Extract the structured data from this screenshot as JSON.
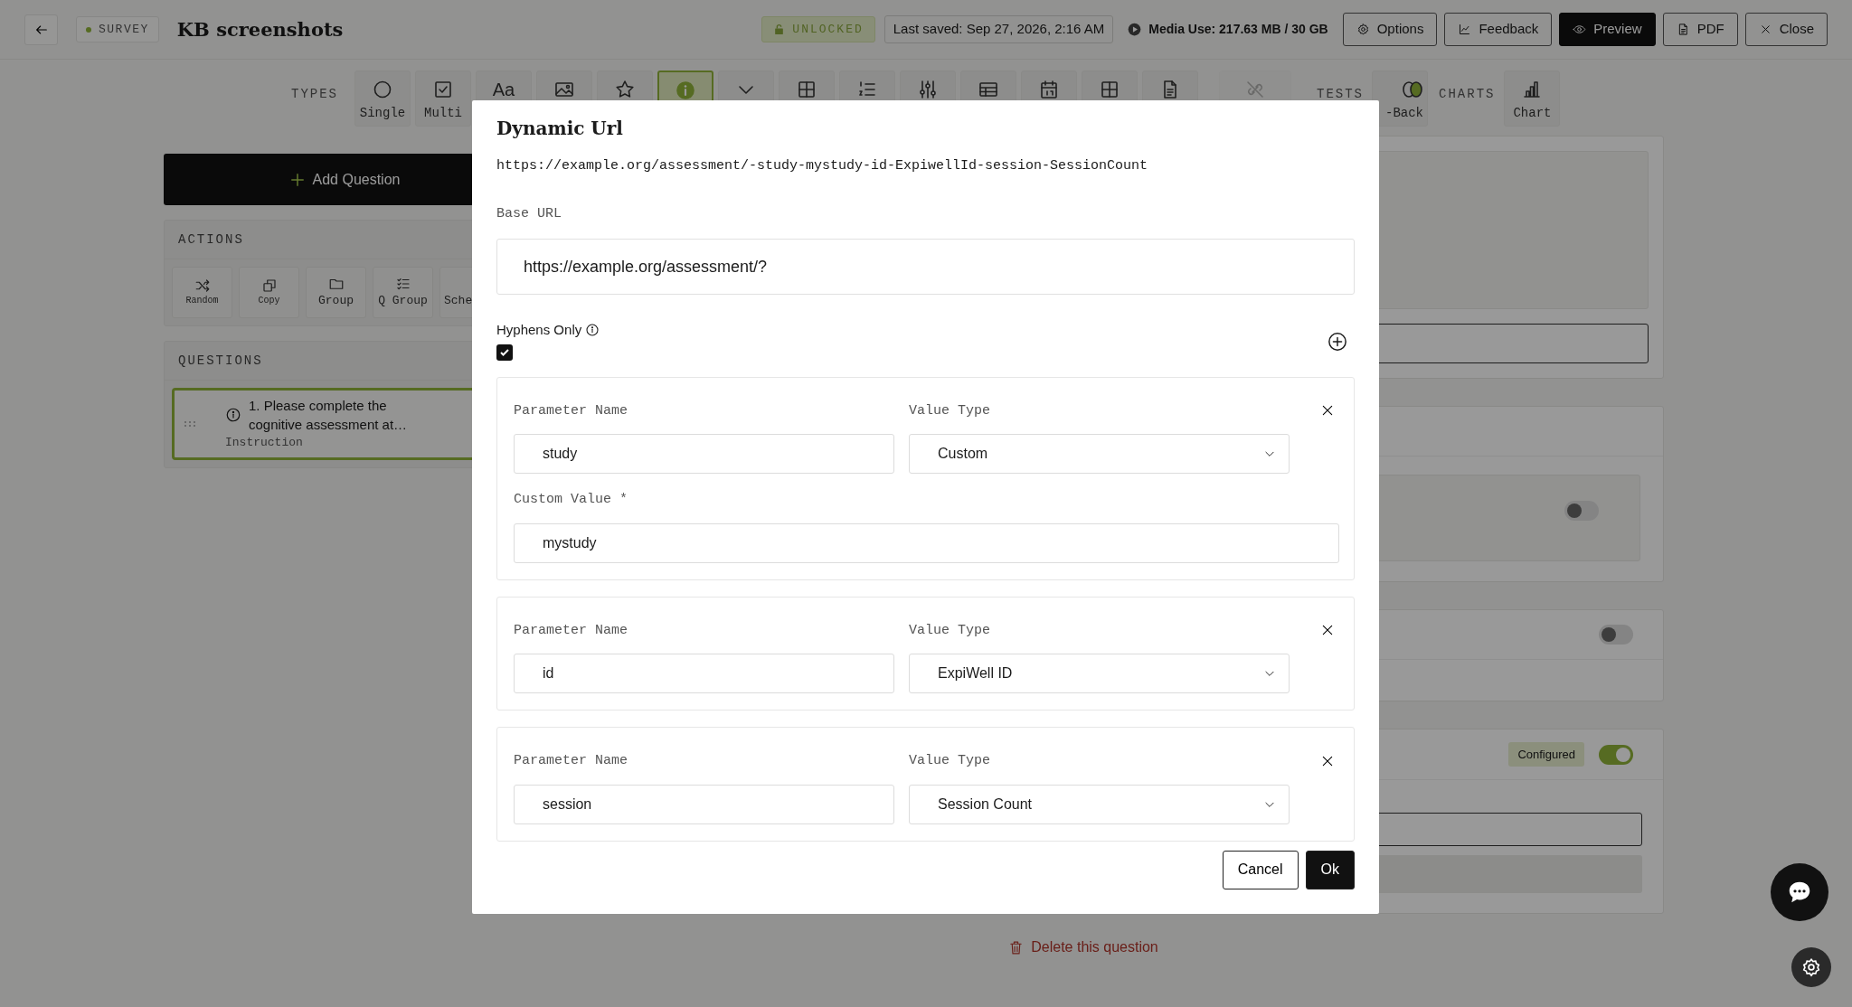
{
  "header": {
    "type_tag": "SURVEY",
    "title": "KB screenshots",
    "lock_status": "UNLOCKED",
    "last_saved": "Last saved: Sep 27, 2026, 2:16 AM",
    "media_use": "Media Use: 217.63 MB / 30 GB",
    "buttons": [
      {
        "kind": "gear",
        "label": "Options",
        "primary": false
      },
      {
        "kind": "chart-line",
        "label": "Feedback",
        "primary": false
      },
      {
        "kind": "eye",
        "label": "Preview",
        "primary": true
      },
      {
        "kind": "file",
        "label": "PDF",
        "primary": false
      },
      {
        "kind": "x",
        "label": "Close",
        "primary": false
      }
    ]
  },
  "toolbar": {
    "types_label": "TYPES",
    "types": [
      {
        "kind": "circle",
        "label": "Single",
        "selected": false,
        "disabled": false
      },
      {
        "kind": "checkbox",
        "label": "Multi",
        "selected": false,
        "disabled": false
      },
      {
        "kind": "glyph",
        "glyph": "Aa",
        "selected": false,
        "disabled": false
      },
      {
        "kind": "image",
        "selected": false,
        "disabled": false
      },
      {
        "kind": "star",
        "selected": false,
        "disabled": false
      },
      {
        "kind": "info",
        "selected": true,
        "disabled": false
      },
      {
        "kind": "chevron",
        "selected": false,
        "disabled": false
      },
      {
        "kind": "grid",
        "selected": false,
        "disabled": false
      },
      {
        "kind": "numlist",
        "selected": false,
        "disabled": false
      },
      {
        "kind": "sliders",
        "selected": false,
        "disabled": false
      },
      {
        "kind": "table",
        "selected": false,
        "disabled": false
      },
      {
        "kind": "calendar",
        "selected": false,
        "disabled": false
      },
      {
        "kind": "grid",
        "selected": false,
        "disabled": false
      },
      {
        "kind": "file",
        "selected": false,
        "disabled": false
      },
      {
        "kind": "link",
        "selected": false,
        "disabled": true
      }
    ],
    "tests_label": "TESTS",
    "tests": [
      {
        "kind": "brain",
        "label": "-Back"
      }
    ],
    "charts_label": "CHARTS",
    "charts": [
      {
        "kind": "bars",
        "label": "Chart"
      }
    ]
  },
  "sidebar": {
    "add_button": "Add Question",
    "actions_label": "ACTIONS",
    "actions": [
      {
        "kind": "shuffle",
        "label": "Random"
      },
      {
        "kind": "copy",
        "label": "Copy"
      },
      {
        "kind": "folder",
        "label": "Group"
      },
      {
        "kind": "checklist",
        "label": "Q Group"
      },
      {
        "label": "Sche"
      }
    ],
    "questions_label": "QUESTIONS",
    "questions": [
      {
        "title": "1. Please complete the cognitive assessment at…",
        "type": "Instruction",
        "selected": true
      }
    ]
  },
  "editor": {
    "panels": [
      {
        "kind": "text-area"
      },
      {
        "kind": "toggle-box",
        "on": false
      },
      {
        "kind": "toggle-header",
        "on": false
      },
      {
        "kind": "configured",
        "badge": "Configured",
        "on": true
      }
    ],
    "delete_button": "Delete this question"
  },
  "dialog": {
    "title": "Dynamic Url",
    "preview_url": "https://example.org/assessment/-study-mystudy-id-ExpiwellId-session-SessionCount",
    "base_url_label": "Base URL",
    "base_url": "https://example.org/assessment/?",
    "hyphens_only": {
      "label": "Hyphens Only",
      "checked": true
    },
    "parameters": [
      {
        "name_label": "Parameter Name",
        "name": "study",
        "type_label": "Value Type",
        "type": "Custom",
        "custom_label": "Custom Value *",
        "custom_value": "mystudy"
      },
      {
        "name_label": "Parameter Name",
        "name": "id",
        "type_label": "Value Type",
        "type": "ExpiWell ID"
      },
      {
        "name_label": "Parameter Name",
        "name": "session",
        "type_label": "Value Type",
        "type": "Session Count"
      }
    ],
    "buttons": [
      {
        "label": "Cancel",
        "primary": false
      },
      {
        "label": "Ok",
        "primary": true
      }
    ]
  }
}
